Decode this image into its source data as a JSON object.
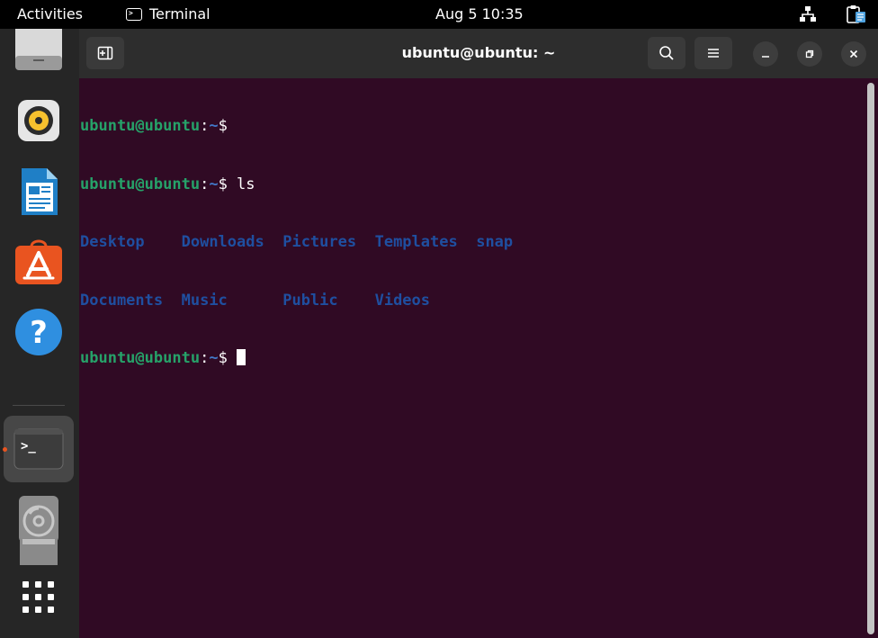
{
  "topbar": {
    "activities": "Activities",
    "app_name": "Terminal",
    "clock": "Aug 5  10:35"
  },
  "dock": {
    "items": [
      {
        "name": "files-icon"
      },
      {
        "name": "rhythmbox-icon"
      },
      {
        "name": "libreoffice-writer-icon"
      },
      {
        "name": "ubuntu-software-icon"
      },
      {
        "name": "help-icon"
      },
      {
        "name": "terminal-icon"
      },
      {
        "name": "optical-drive-icon"
      },
      {
        "name": "drive-icon"
      },
      {
        "name": "show-apps-icon"
      }
    ],
    "terminal_glyph": ">_"
  },
  "window": {
    "title": "ubuntu@ubuntu: ~"
  },
  "terminal": {
    "user_host": "ubuntu@ubuntu",
    "colon": ":",
    "path": "~",
    "dollar": "$ ",
    "command": "ls",
    "dirs_row1": [
      "Desktop",
      "Downloads",
      "Pictures",
      "Templates",
      "snap"
    ],
    "dirs_row2": [
      "Documents",
      "Music",
      "Public",
      "Videos"
    ]
  },
  "colors": {
    "terminal_bg": "#300a24",
    "prompt_user": "#26a269",
    "prompt_path": "#4279c9",
    "dir_text": "#1f4fa0",
    "ubuntu_orange": "#e95420"
  }
}
